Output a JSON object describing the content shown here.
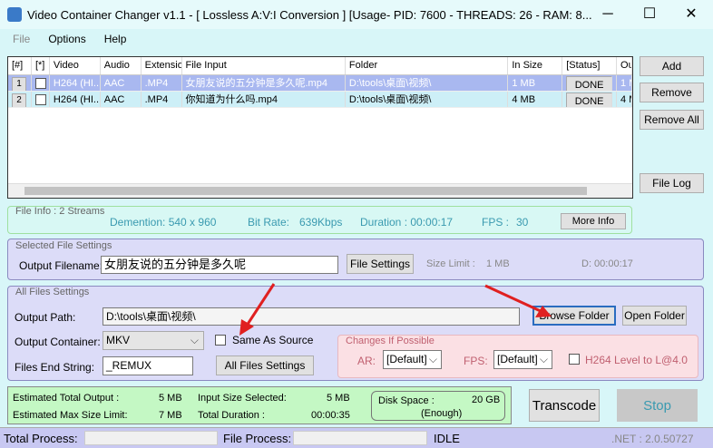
{
  "window": {
    "title": "Video Container Changer v1.1 - [ Lossless A:V:I Conversion ] [Usage- PID: 7600 - THREADS: 26 - RAM: 8...",
    "minimize": "─",
    "maximize": "☐",
    "close": "✕"
  },
  "menu": [
    "File",
    "Options",
    "Help"
  ],
  "list": {
    "columns": [
      "[#]",
      "[*]",
      "Video",
      "Audio",
      "Extensio",
      "File Input",
      "Folder",
      "In Size",
      "[Status]",
      "Ou"
    ],
    "rows": [
      {
        "num": "1",
        "video": "H264 (HI...",
        "audio": "AAC",
        "ext": ".MP4",
        "file": "女朋友说的五分钟是多久呢.mp4",
        "folder": "D:\\tools\\桌面\\视频\\",
        "size": "1 MB",
        "status": "DONE",
        "out": "1 M"
      },
      {
        "num": "2",
        "video": "H264 (HI...",
        "audio": "AAC",
        "ext": ".MP4",
        "file": "你知道为什么吗.mp4",
        "folder": "D:\\tools\\桌面\\视频\\",
        "size": "4 MB",
        "status": "DONE",
        "out": "4 M"
      }
    ]
  },
  "side": {
    "add": "Add",
    "remove": "Remove",
    "remove_all": "Remove All",
    "file_log": "File Log"
  },
  "file_info": {
    "label": "File Info : 2 Streams",
    "dimension": "Demention: 540 x 960",
    "bitrate_label": "Bit Rate:",
    "bitrate": "639Kbps",
    "duration": "Duration : 00:00:17",
    "fps_label": "FPS :",
    "fps": "30",
    "more": "More Info"
  },
  "selected": {
    "label": "Selected File Settings",
    "filename_label": "Output Filename:",
    "filename": "女朋友说的五分钟是多久呢",
    "file_settings": "File Settings",
    "size_limit_label": "Size Limit :",
    "size_limit": "1 MB",
    "d": "D: 00:00:17"
  },
  "all": {
    "label": "All Files Settings",
    "path_label": "Output Path:",
    "path": "D:\\tools\\桌面\\视频\\",
    "browse": "Browse Folder",
    "open": "Open Folder",
    "container_label": "Output Container:",
    "container": "MKV",
    "same_as_source": "Same As Source",
    "end_label": "Files End String:",
    "end": "_REMUX",
    "all_settings": "All Files Settings",
    "changes": {
      "label": "Changes If Possible",
      "ar_label": "AR:",
      "ar": "[Default]",
      "fps_label": "FPS:",
      "fps": "[Default]",
      "h264": "H264 Level to L@4.0"
    }
  },
  "summary": {
    "est_total_label": "Estimated Total Output :",
    "est_total": "5 MB",
    "est_max_label": "Estimated Max Size Limit:",
    "est_max": "7 MB",
    "input_label": "Input Size Selected:",
    "input": "5 MB",
    "dur_label": "Total Duration :",
    "dur": "00:00:35",
    "disk_label": "Disk Space :",
    "disk": "20 GB",
    "disk_status": "(Enough)"
  },
  "actions": {
    "transcode": "Transcode",
    "stop": "Stop"
  },
  "status": {
    "total": "Total Process:",
    "file": "File Process:",
    "state": "IDLE",
    "net": ".NET :  2.0.50727"
  }
}
